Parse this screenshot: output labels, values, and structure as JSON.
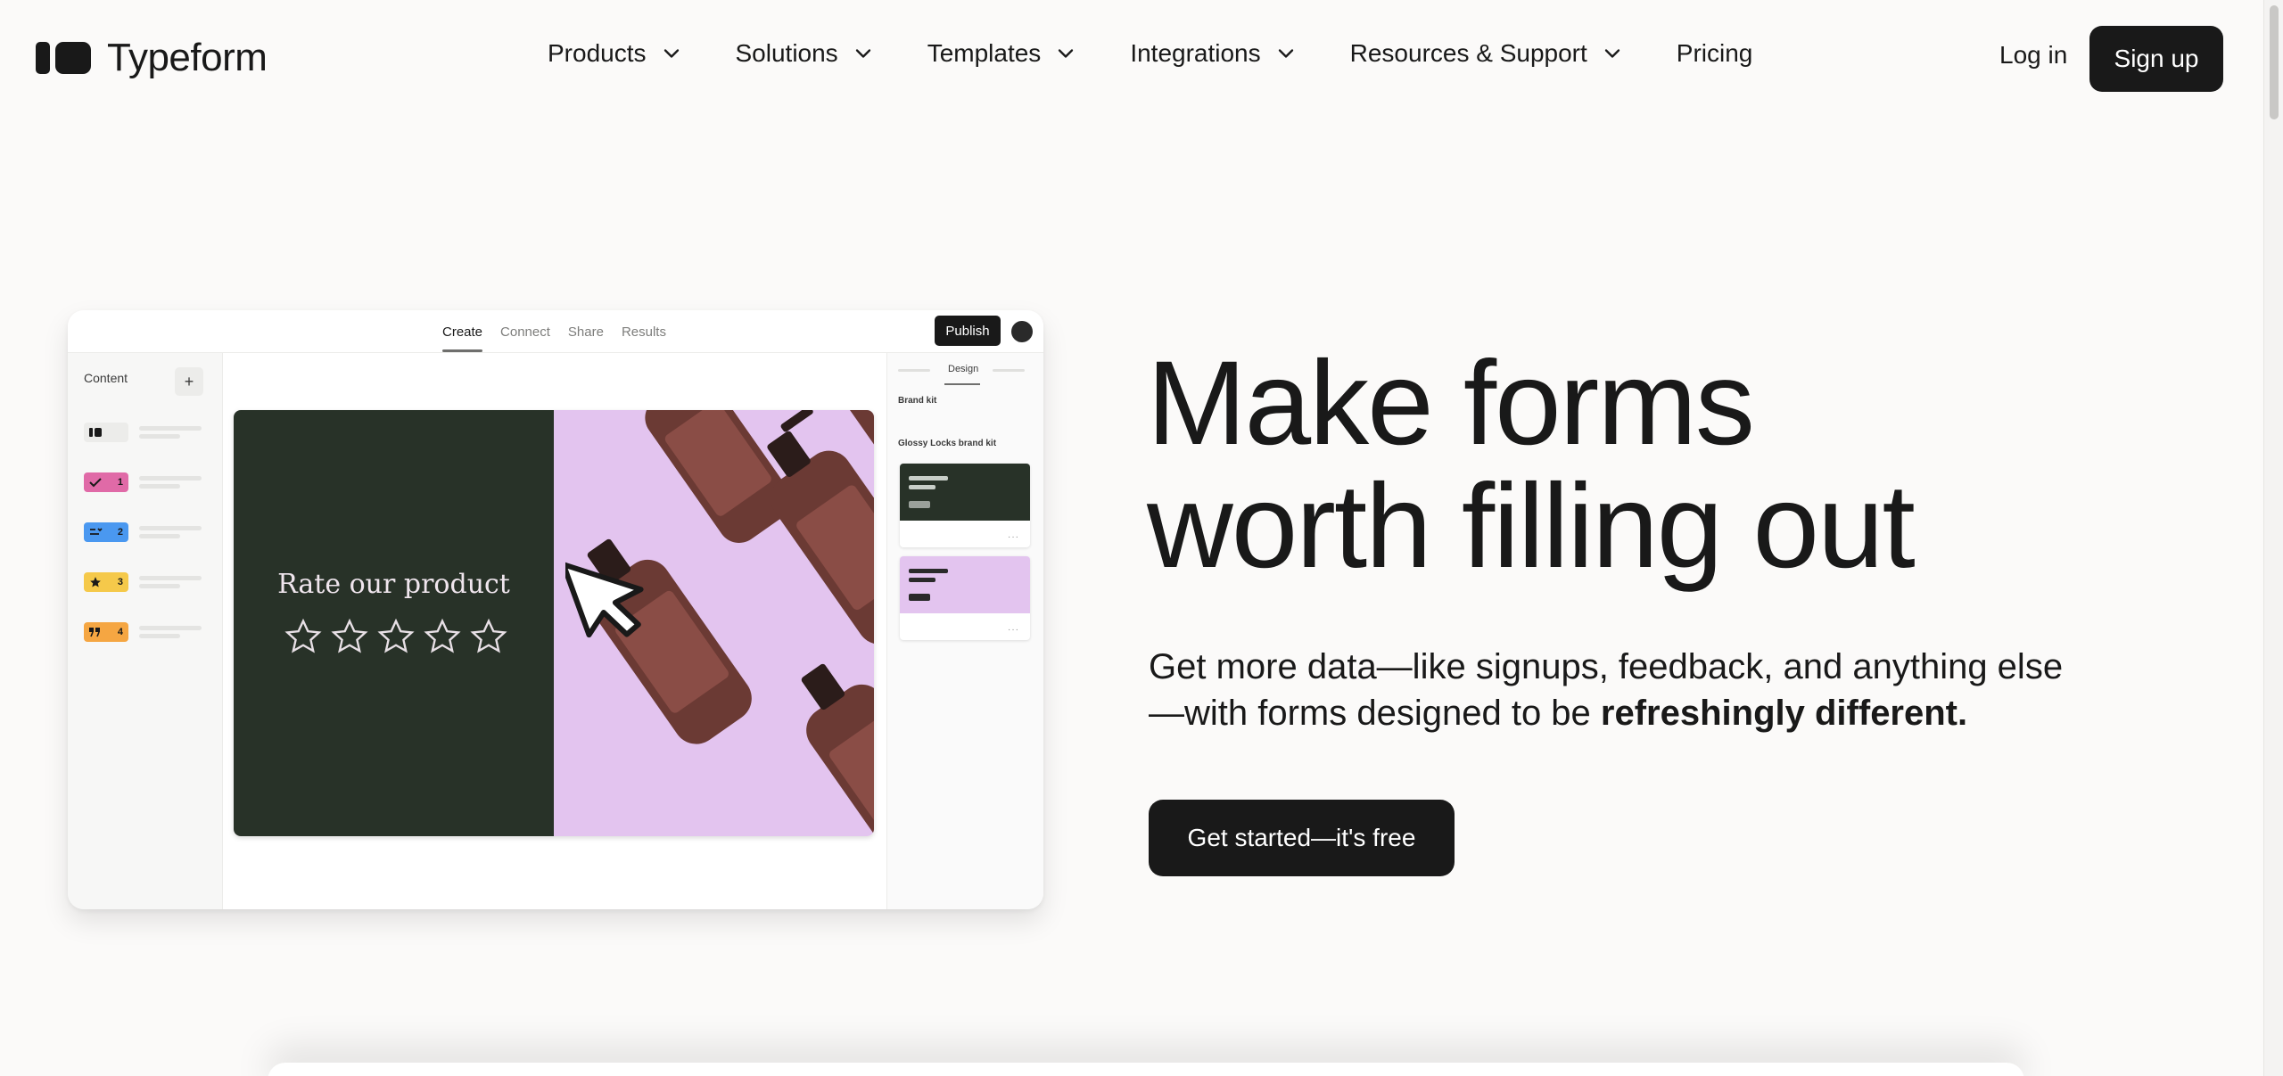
{
  "brand": {
    "name": "Typeform"
  },
  "nav": {
    "items": [
      {
        "label": "Products",
        "has_dropdown": true
      },
      {
        "label": "Solutions",
        "has_dropdown": true
      },
      {
        "label": "Templates",
        "has_dropdown": true
      },
      {
        "label": "Integrations",
        "has_dropdown": true
      },
      {
        "label": "Resources & Support",
        "has_dropdown": true
      },
      {
        "label": "Pricing",
        "has_dropdown": false
      }
    ],
    "login": "Log in",
    "signup": "Sign up"
  },
  "mockup": {
    "tabs": [
      "Create",
      "Connect",
      "Share",
      "Results"
    ],
    "active_tab": "Create",
    "publish": "Publish",
    "sidebar": {
      "title": "Content",
      "add": "+",
      "questions": [
        {
          "number": "",
          "color": "#ececea",
          "icon": "welcome-icon"
        },
        {
          "number": "1",
          "color": "#e06aa7",
          "icon": "check-icon"
        },
        {
          "number": "2",
          "color": "#4a98f0",
          "icon": "dropdown-icon"
        },
        {
          "number": "3",
          "color": "#f5c94a",
          "icon": "star-icon"
        },
        {
          "number": "4",
          "color": "#f5a642",
          "icon": "quote-icon"
        }
      ]
    },
    "canvas": {
      "question": "Rate our product",
      "stars": 5,
      "left_color": "#283228",
      "right_color": "#e3c4ef"
    },
    "design_panel": {
      "tab": "Design",
      "brand_kit": "Brand kit",
      "kit_name": "Glossy Locks brand kit",
      "card_colors": [
        "#283228",
        "#e3c4ef"
      ]
    }
  },
  "hero": {
    "headline_line1": "Make forms",
    "headline_line2": "worth filling out",
    "sub_part1": "Get more data—like signups, feedback, and anything else —with forms designed to be ",
    "sub_bold": "refreshingly different.",
    "cta": "Get started—it's free"
  },
  "colors": {
    "background": "#fbfaf9",
    "text": "#191919",
    "button": "#191919"
  }
}
